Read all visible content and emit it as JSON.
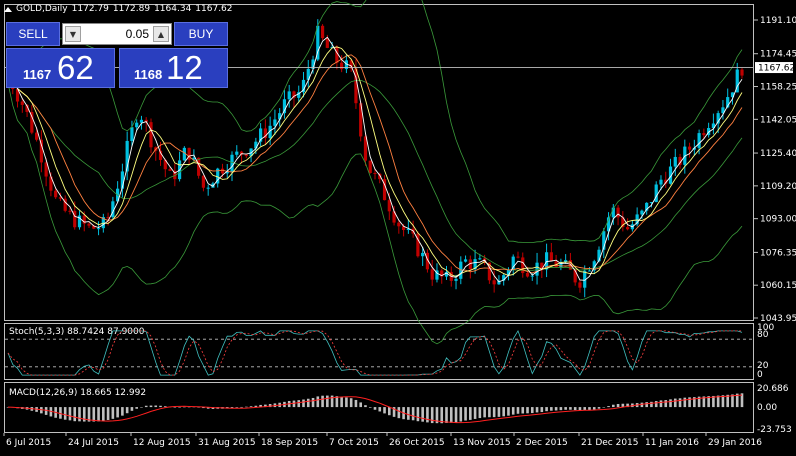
{
  "window": {
    "symbol_label": "GOLD,Daily",
    "ohlc": [
      "1172.79",
      "1172.89",
      "1164.34",
      "1167.62"
    ]
  },
  "trade_panel": {
    "sell_label": "SELL",
    "buy_label": "BUY",
    "lot_value": "0.05",
    "bid_prefix": "1167",
    "bid_big": "62",
    "ask_prefix": "1168",
    "ask_big": "12"
  },
  "price_axis": {
    "ticks": [
      "1191.10",
      "1174.45",
      "1158.25",
      "1142.05",
      "1125.40",
      "1109.20",
      "1093.00",
      "1076.35",
      "1060.15",
      "1043.95"
    ],
    "current": "1167.62"
  },
  "stoch": {
    "label": "Stoch(5,3,3) 88.7424 87.9000",
    "levels": [
      "100",
      "80",
      "20",
      "0"
    ]
  },
  "macd": {
    "label": "MACD(12,26,9) 18.665 12.992",
    "levels": [
      "20.686",
      "0.00",
      "-23.753"
    ]
  },
  "time_axis": {
    "labels": [
      "6 Jul 2015",
      "24 Jul 2015",
      "12 Aug 2015",
      "31 Aug 2015",
      "18 Sep 2015",
      "7 Oct 2015",
      "26 Oct 2015",
      "13 Nov 2015",
      "2 Dec 2015",
      "21 Dec 2015",
      "11 Jan 2016",
      "29 Jan 2016"
    ]
  },
  "colors": {
    "bull": "#00c0e0",
    "bear": "#c00000",
    "bands": "#3a9a3a",
    "ma_fast": "#ffffff",
    "ma_mid": "#ffff80",
    "ma_slow": "#ff8040",
    "stoch_main": "#40c0c0",
    "stoch_signal": "#ff4040",
    "macd_hist": "#c0c0c0",
    "macd_signal": "#ff2020"
  },
  "chart_data": {
    "type": "line",
    "series": [
      {
        "values": [
          1164,
          1148,
          1126,
          1100,
          1093,
          1088,
          1090,
          1118,
          1148,
          1128,
          1112,
          1128,
          1108,
          1118,
          1124,
          1130,
          1138,
          1150,
          1156,
          1184,
          1172,
          1166,
          1120,
          1106,
          1090,
          1080,
          1066,
          1062,
          1072,
          1070,
          1060,
          1074,
          1068,
          1072,
          1070,
          1062,
          1076,
          1098,
          1088,
          1096,
          1112,
          1120,
          1130,
          1142,
          1152,
          1168
        ]
      }
    ]
  }
}
